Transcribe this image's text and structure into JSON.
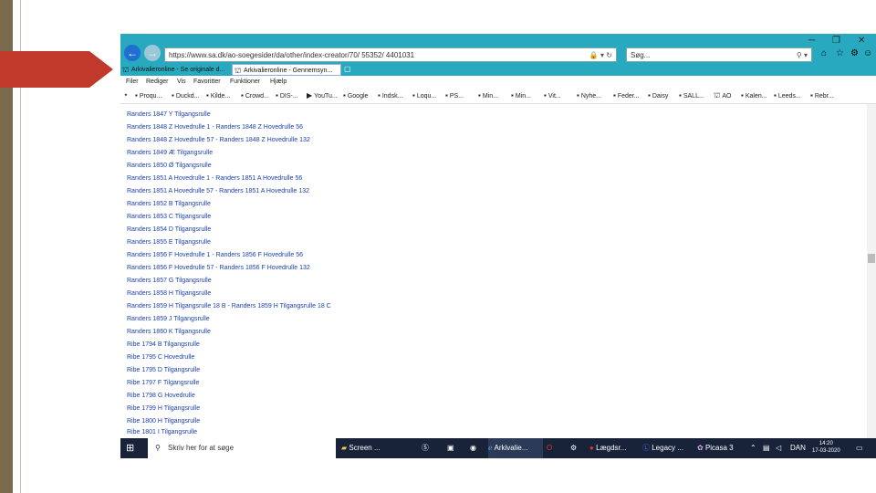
{
  "browser": {
    "url": "https://www.sa.dk/ao-soegesider/da/other/index-creator/70/ 55352/ 4401031",
    "search_placeholder": "Søg...",
    "tabs": [
      {
        "label": "Arkivalieronline - Se originale d..."
      },
      {
        "label": "Arkivalieronline - Gennemsyn..."
      }
    ],
    "menu": [
      "Filer",
      "Rediger",
      "Vis",
      "Favoritter",
      "Funktioner",
      "Hjælp"
    ],
    "favorites": [
      "Proqu...",
      "Duckd...",
      "Kilde...",
      "Crowd...",
      "DIS-...",
      "YouTu...",
      "Google",
      "Indsk...",
      "Loqu...",
      "PS...",
      "Min...",
      "Min...",
      "Vit...",
      "Nyhe...",
      "Feder...",
      "Daisy",
      "SALL...",
      "AO",
      "Kalen...",
      "Leeds...",
      "Rebr..."
    ]
  },
  "links": [
    "Randers 1847 Y Tilgangsrulle",
    "Randers 1848 Z Hovedrulle 1 - Randers 1848 Z Hovedrulle 56",
    "Randers 1848 Z Hovedrulle 57 - Randers 1848 Z Hovedrulle 132",
    "Randers 1849 Æ Tilgangsrulle",
    "Randers 1850 Ø Tilgangsrulle",
    "Randers 1851 A Hovedrulle 1 - Randers 1851 A Hovedrulle 56",
    "Randers 1851 A Hovedrulle 57 - Randers 1851 A Hovedrulle 132",
    "Randers 1852 B Tilgangsrulle",
    "Randers 1853 C Tilgangsrulle",
    "Randers 1854 D Tilgangsrulle",
    "Randers 1855 E Tilgangsrulle",
    "Randers 1856 F Hovedrulle 1 - Randers 1856 F Hovedrulle 56",
    "Randers 1856 F Hovedrulle 57 - Randers 1856 F Hovedrulle 132",
    "Randers 1857 G Tilgangsrulle",
    "Randers 1858 H Tilgangsrulle",
    "Randers 1859 H Tilgangsrulle 18 B - Randers 1859 H Tilgangsrulle 18 C",
    "Randers 1859 J Tilgangsrulle",
    "Randers 1860 K Tilgangsrulle",
    "Ribe 1794 B Tilgangsrulle",
    "Ribe 1795 C Hovedrulle",
    "Ribe 1795 D Tilgangsrulle",
    "Ribe 1797 F Tilgangsrulle",
    "Ribe 1798 G Hovedrulle",
    "Ribe 1799 H Tilgangsrulle",
    "Ribe 1800 H Tilgangsrulle",
    "Ribe 1801 I Tilgangsrulle"
  ],
  "taskbar": {
    "search_placeholder": "Skriv her for at søge",
    "apps": [
      "Screen ...",
      "Arkivalie...",
      "Lægdsr...",
      "Legacy ...",
      "Picasa 3"
    ],
    "language": "DAN",
    "time": "14:20",
    "date": "17-03-2020"
  },
  "colors": {
    "browser_chrome": "#29a9bf",
    "link": "#1a3fb3",
    "taskbar": "#18233a",
    "slide_bar": "#7a6b4f",
    "slide_arrow": "#c0392b"
  }
}
